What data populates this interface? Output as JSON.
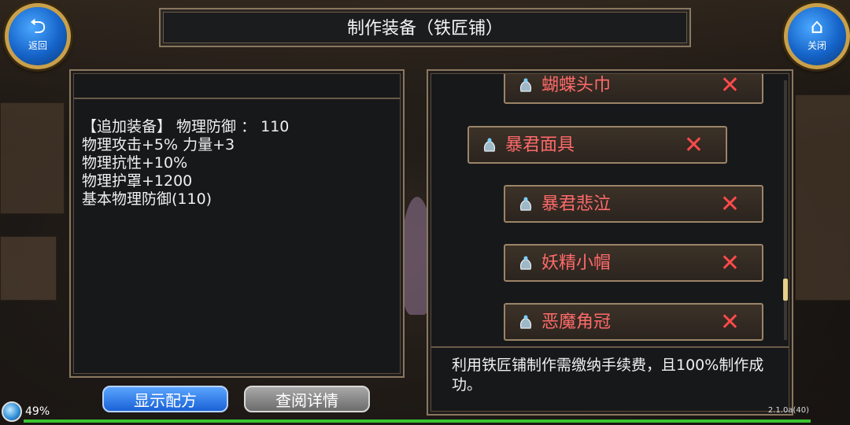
{
  "header": {
    "title": "制作装备（铁匠铺）"
  },
  "nav": {
    "back_label": "返回",
    "close_label": "关闭"
  },
  "details": {
    "lines": [
      "【追加装备】 物理防御 ： 110",
      "物理攻击+5% 力量+3",
      "物理抗性+10%",
      "物理护罩+1200",
      "基本物理防御(110)"
    ]
  },
  "recipe_list": {
    "items": [
      {
        "name": "蝴蝶头巾",
        "remove": "✕"
      },
      {
        "name": "暴君面具",
        "remove": "✕"
      },
      {
        "name": "暴君悲泣",
        "remove": "✕"
      },
      {
        "name": "妖精小帽",
        "remove": "✕"
      },
      {
        "name": "恶魔角冠",
        "remove": "✕"
      }
    ],
    "selected_index": 1,
    "icon": "item-bag-icon"
  },
  "note": {
    "text": "利用铁匠铺制作需缴纳手续费，且100%制作成功。"
  },
  "buttons": {
    "show_recipe": "显示配方",
    "view_details": "查阅详情"
  },
  "status": {
    "battery_percent": "49%",
    "version": "2.1.0a(40)"
  },
  "colors": {
    "item_name": "#ff6a6a",
    "remove_x": "#ff4a4a",
    "frame": "#8a7760",
    "primary_button": "#1a62d6"
  }
}
